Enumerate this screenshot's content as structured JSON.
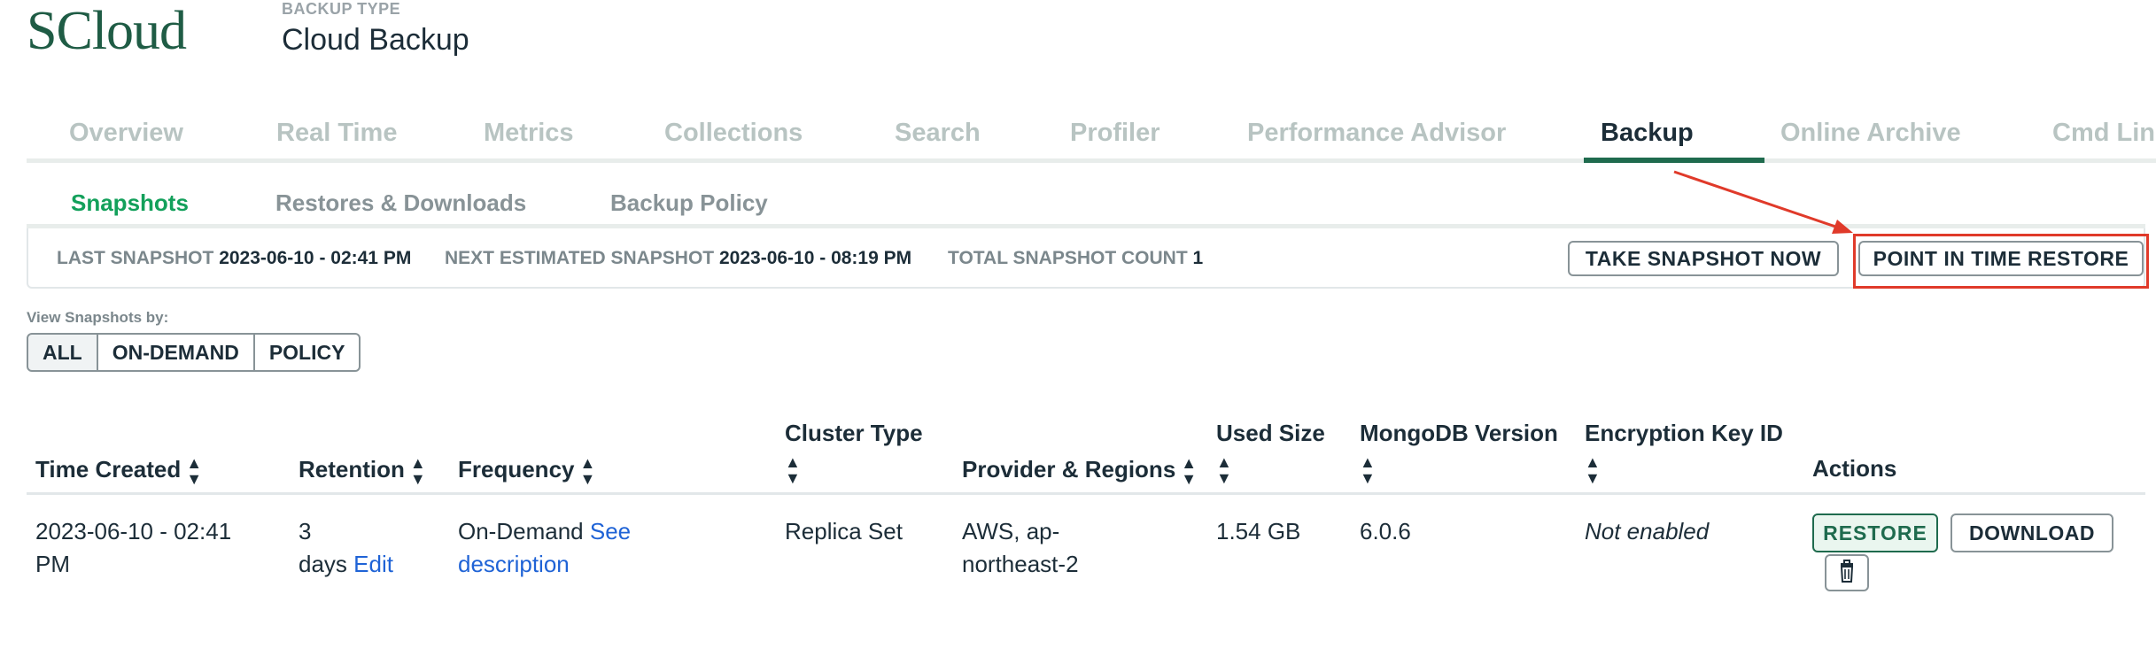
{
  "header": {
    "logo": "SCloud",
    "backup_type_label": "BACKUP TYPE",
    "backup_type_value": "Cloud Backup"
  },
  "tabs": [
    {
      "label": "Overview",
      "active": false
    },
    {
      "label": "Real Time",
      "active": false
    },
    {
      "label": "Metrics",
      "active": false
    },
    {
      "label": "Collections",
      "active": false
    },
    {
      "label": "Search",
      "active": false
    },
    {
      "label": "Profiler",
      "active": false
    },
    {
      "label": "Performance Advisor",
      "active": false
    },
    {
      "label": "Backup",
      "active": true
    },
    {
      "label": "Online Archive",
      "active": false
    },
    {
      "label": "Cmd Lin",
      "active": false
    }
  ],
  "subtabs": [
    {
      "label": "Snapshots",
      "active": true
    },
    {
      "label": "Restores & Downloads",
      "active": false
    },
    {
      "label": "Backup Policy",
      "active": false
    }
  ],
  "info_bar": {
    "last_snapshot_label": "LAST SNAPSHOT",
    "last_snapshot_value": "2023-06-10 - 02:41 PM",
    "next_snapshot_label": "NEXT ESTIMATED SNAPSHOT",
    "next_snapshot_value": "2023-06-10 - 08:19 PM",
    "total_count_label": "TOTAL SNAPSHOT COUNT",
    "total_count_value": "1",
    "take_snapshot_button": "TAKE SNAPSHOT NOW",
    "pit_restore_button": "POINT IN TIME RESTORE"
  },
  "view_by": {
    "label": "View Snapshots by:",
    "options": [
      "ALL",
      "ON-DEMAND",
      "POLICY"
    ],
    "selected": "ALL"
  },
  "table": {
    "columns": [
      "Time Created",
      "Retention",
      "Frequency",
      "Cluster Type",
      "Provider & Regions",
      "Used Size",
      "MongoDB Version",
      "Encryption Key ID",
      "Actions"
    ],
    "rows": [
      {
        "time_created_line1": "2023-06-10 - 02:41",
        "time_created_line2": "PM",
        "retention_line1": "3",
        "retention_line2": "days",
        "retention_edit": "Edit",
        "frequency": "On-Demand",
        "frequency_link_line1": "See",
        "frequency_link_line2": "description",
        "cluster_type": "Replica Set",
        "provider_line1": "AWS, ap-",
        "provider_line2": "northeast-2",
        "used_size": "1.54 GB",
        "mongodb_version": "6.0.6",
        "encryption_key_id": "Not enabled",
        "restore_button": "RESTORE",
        "download_button": "DOWNLOAD"
      }
    ]
  },
  "icons": {
    "sort": "sort-icon",
    "trash": "trash-icon"
  },
  "colors": {
    "brand": "#1f5c45",
    "active_tab_underline": "#1f6b4e",
    "active_subtab": "#13a05b",
    "link": "#1f63d6",
    "annotation_red": "#e03a2a"
  }
}
